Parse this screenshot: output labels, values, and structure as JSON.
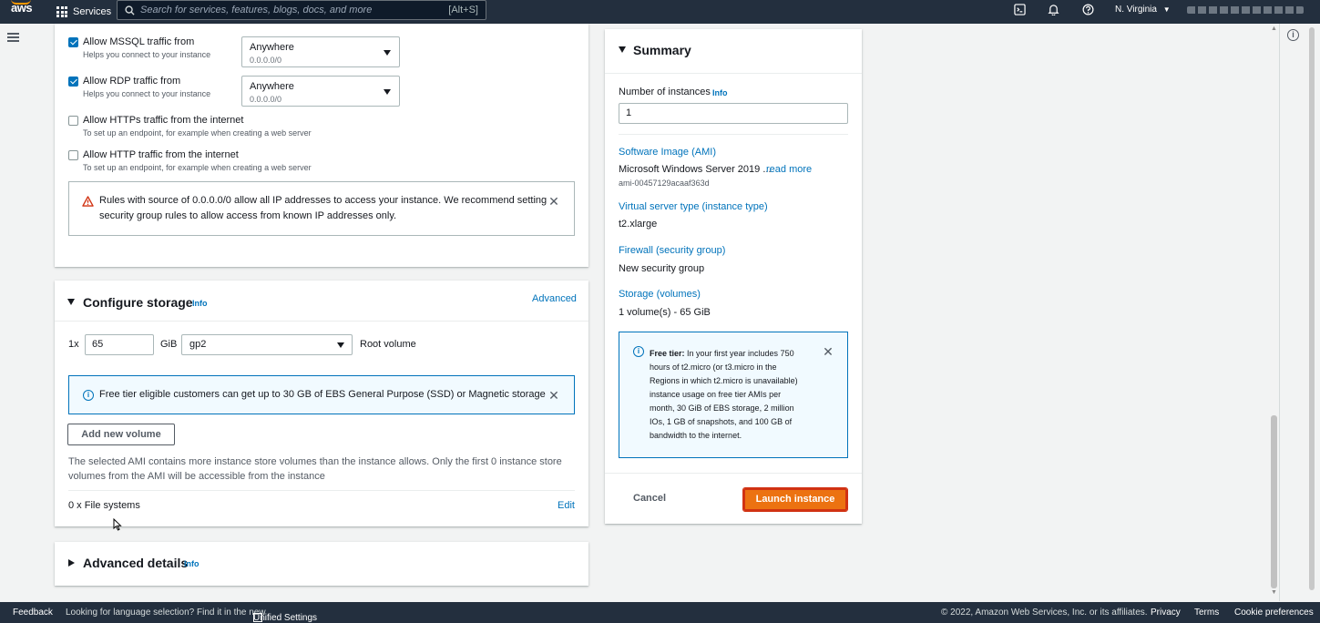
{
  "topnav": {
    "logo_text": "aws",
    "services_label": "Services",
    "search_placeholder": "Search for services, features, blogs, docs, and more",
    "search_shortcut": "[Alt+S]",
    "region": "N. Virginia"
  },
  "network": {
    "mssql": {
      "label": "Allow MSSQL traffic from",
      "desc": "Helps you connect to your instance",
      "checked": true,
      "select_value": "Anywhere",
      "select_sub": "0.0.0.0/0"
    },
    "rdp": {
      "label": "Allow RDP traffic from",
      "desc": "Helps you connect to your instance",
      "checked": true,
      "select_value": "Anywhere",
      "select_sub": "0.0.0.0/0"
    },
    "https": {
      "label": "Allow HTTPs traffic from the internet",
      "desc": "To set up an endpoint, for example when creating a web server",
      "checked": false
    },
    "http": {
      "label": "Allow HTTP traffic from the internet",
      "desc": "To set up an endpoint, for example when creating a web server",
      "checked": false
    },
    "warning_line1": "Rules with source of 0.0.0.0/0 allow all IP addresses to access your instance. We recommend setting",
    "warning_line2": "security group rules to allow access from known IP addresses only."
  },
  "storage": {
    "title": "Configure storage",
    "info": "Info",
    "advanced": "Advanced",
    "count_prefix": "1x",
    "size": "65",
    "unit": "GiB",
    "volume_type": "gp2",
    "root_label": "Root volume",
    "free_tier_msg": "Free tier eligible customers can get up to 30 GB of EBS General Purpose (SSD) or Magnetic storage",
    "add_volume": "Add new volume",
    "ami_note_line1": "The selected AMI contains more instance store volumes than the instance allows. Only the first 0 instance store",
    "ami_note_line2": "volumes from the AMI will be accessible from the instance",
    "file_systems": "0 x File systems",
    "edit": "Edit"
  },
  "advanced_details": {
    "title": "Advanced details",
    "info": "Info"
  },
  "summary": {
    "title": "Summary",
    "num_instances_label": "Number of instances",
    "info": "Info",
    "num_instances_value": "1",
    "ami_label": "Software Image (AMI)",
    "ami_value": "Microsoft Windows Server 2019 ...",
    "ami_read_more": "read more",
    "ami_id": "ami-00457129acaaf363d",
    "instance_type_label": "Virtual server type (instance type)",
    "instance_type_value": "t2.xlarge",
    "firewall_label": "Firewall (security group)",
    "firewall_value": "New security group",
    "storage_label": "Storage (volumes)",
    "storage_value": "1 volume(s) - 65 GiB",
    "free_tier_title": "Free tier:",
    "free_tier_lines": [
      " In your first year includes 750",
      "hours of t2.micro (or t3.micro in the",
      "Regions in which t2.micro is unavailable)",
      "instance usage on free tier AMIs per",
      "month, 30 GiB of EBS storage, 2 million",
      "IOs, 1 GB of snapshots, and 100 GB of",
      "bandwidth to the internet."
    ],
    "cancel": "Cancel",
    "launch": "Launch instance"
  },
  "footer": {
    "feedback": "Feedback",
    "lang_msg": "Looking for language selection? Find it in the new",
    "unified": "Unified Settings",
    "copyright": "© 2022, Amazon Web Services, Inc. or its affiliates.",
    "privacy": "Privacy",
    "terms": "Terms",
    "cookies": "Cookie preferences"
  },
  "colors": {
    "nav_bg": "#232f3e",
    "link": "#0073bb",
    "primary": "#ec7211",
    "highlight": "#d13212"
  }
}
